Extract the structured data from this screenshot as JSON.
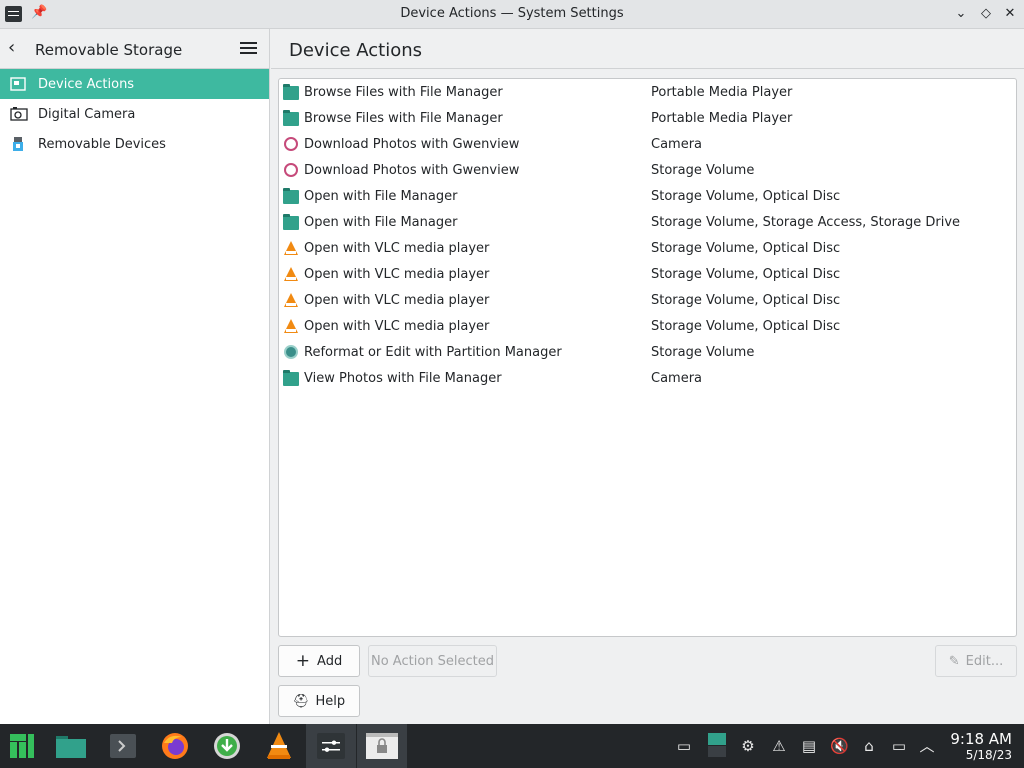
{
  "window": {
    "title": "Device Actions — System Settings",
    "pin_glyph": "📌",
    "minimize_glyph": "⌄",
    "maximize_glyph": "◇",
    "close_glyph": "✕"
  },
  "sidebar": {
    "title": "Removable Storage",
    "back_glyph": "‹",
    "items": [
      {
        "label": "Device Actions",
        "icon": "device-actions-icon"
      },
      {
        "label": "Digital Camera",
        "icon": "camera-icon"
      },
      {
        "label": "Removable Devices",
        "icon": "usb-icon"
      }
    ]
  },
  "main": {
    "title": "Device Actions",
    "actions": [
      {
        "name": "Browse Files with File Manager",
        "types": "Portable Media Player",
        "icon": "folder"
      },
      {
        "name": "Browse Files with File Manager",
        "types": "Portable Media Player",
        "icon": "folder"
      },
      {
        "name": "Download Photos with Gwenview",
        "types": "Camera",
        "icon": "gwenview"
      },
      {
        "name": "Download Photos with Gwenview",
        "types": "Storage Volume",
        "icon": "gwenview"
      },
      {
        "name": "Open with File Manager",
        "types": "Storage Volume, Optical Disc",
        "icon": "folder"
      },
      {
        "name": "Open with File Manager",
        "types": "Storage Volume, Storage Access, Storage Drive",
        "icon": "folder"
      },
      {
        "name": "Open with VLC media player",
        "types": "Storage Volume, Optical Disc",
        "icon": "vlc"
      },
      {
        "name": "Open with VLC media player",
        "types": "Storage Volume, Optical Disc",
        "icon": "vlc"
      },
      {
        "name": "Open with VLC media player",
        "types": "Storage Volume, Optical Disc",
        "icon": "vlc"
      },
      {
        "name": "Open with VLC media player",
        "types": "Storage Volume, Optical Disc",
        "icon": "vlc"
      },
      {
        "name": "Reformat or Edit with Partition Manager",
        "types": "Storage Volume",
        "icon": "partition"
      },
      {
        "name": "View Photos with File Manager",
        "types": "Camera",
        "icon": "folder"
      }
    ],
    "buttons": {
      "add": "Add",
      "add_glyph": "+",
      "no_action": "No Action Selected",
      "edit": "Edit...",
      "edit_glyph": "✎",
      "help": "Help",
      "help_glyph": "⛑"
    }
  },
  "taskbar": {
    "time": "9:18 AM",
    "date": "5/18/23",
    "tray_glyphs": [
      "▭",
      "▦",
      "⚙",
      "⚠",
      "▤",
      "🔇",
      "⌂",
      "▭",
      "︿"
    ]
  },
  "colors": {
    "accent": "#3eb9a0",
    "taskbar": "#232629"
  }
}
